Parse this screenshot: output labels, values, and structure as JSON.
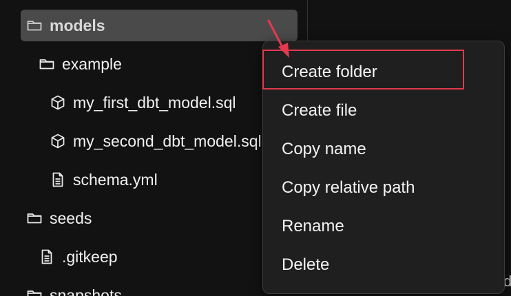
{
  "tree": {
    "items": [
      {
        "label": "models",
        "icon": "folder-icon"
      },
      {
        "label": "example",
        "icon": "folder-icon"
      },
      {
        "label": "my_first_dbt_model.sql",
        "icon": "cube-icon"
      },
      {
        "label": "my_second_dbt_model.sql",
        "icon": "cube-icon"
      },
      {
        "label": "schema.yml",
        "icon": "file-text-icon"
      },
      {
        "label": "seeds",
        "icon": "folder-icon"
      },
      {
        "label": ".gitkeep",
        "icon": "file-text-icon"
      },
      {
        "label": "snapshots",
        "icon": "folder-icon"
      }
    ]
  },
  "context_menu": {
    "items": [
      {
        "label": "Create folder"
      },
      {
        "label": "Create file"
      },
      {
        "label": "Copy name"
      },
      {
        "label": "Copy relative path"
      },
      {
        "label": "Rename"
      },
      {
        "label": "Delete"
      }
    ]
  },
  "edge_text": "de",
  "colors": {
    "background": "#121212",
    "selected_row": "#4a4a4a",
    "menu_background": "#1f1f1f",
    "annotation_red": "#e33a4e"
  }
}
